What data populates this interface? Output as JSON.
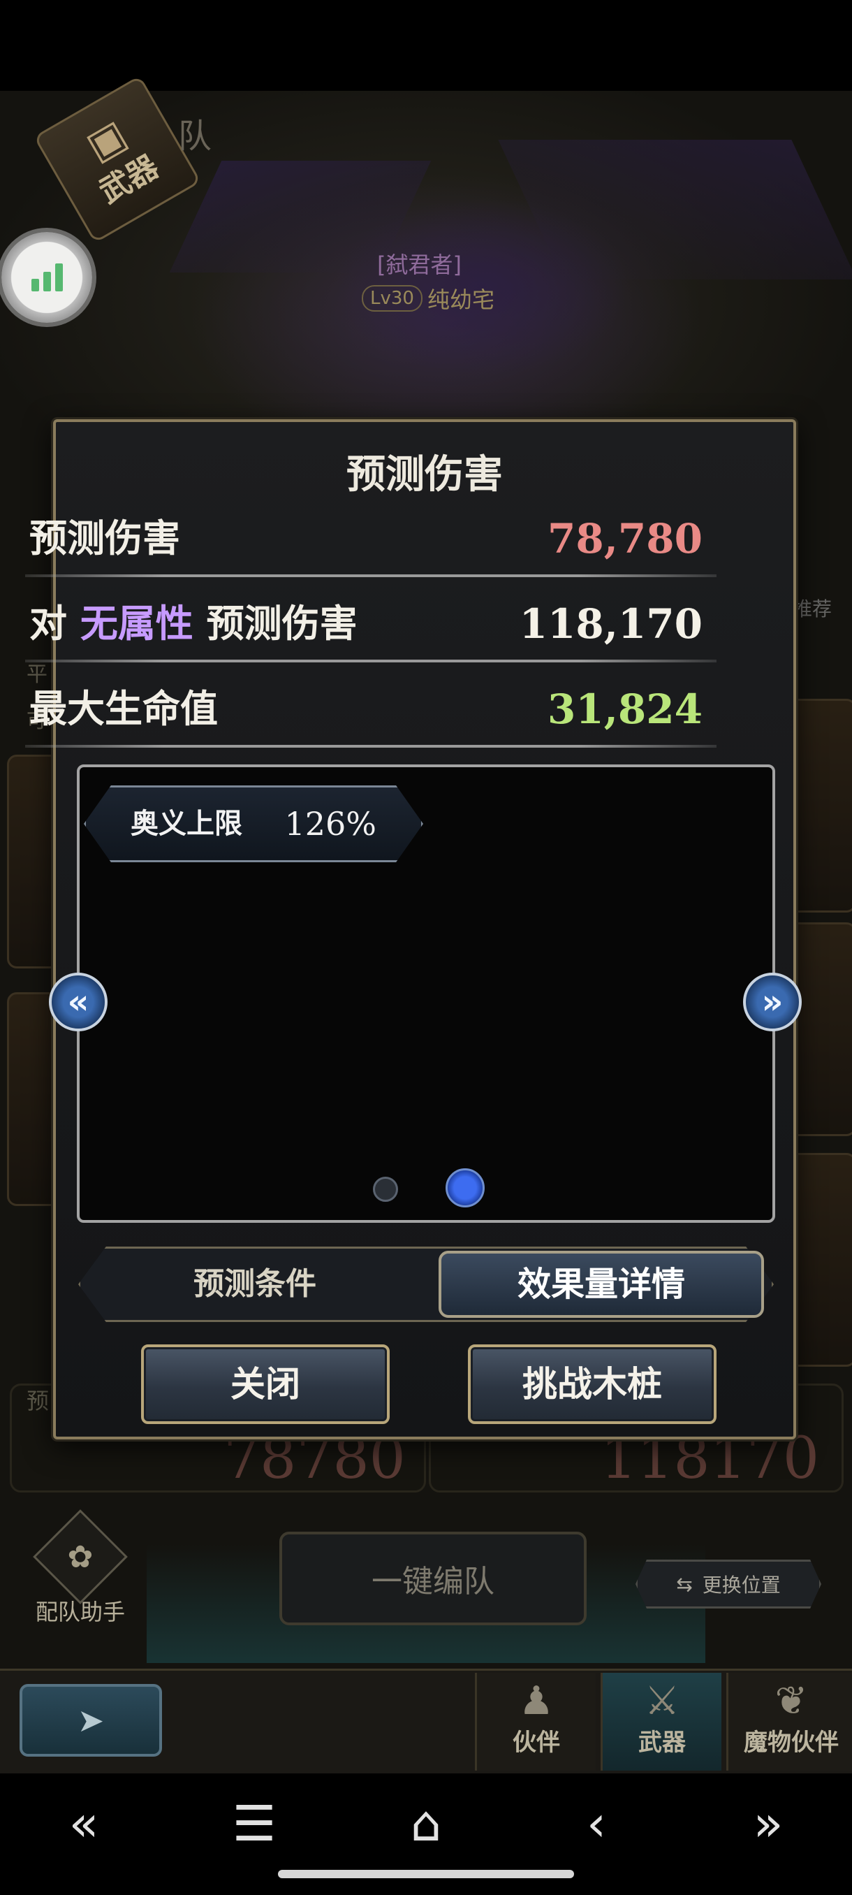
{
  "background": {
    "weapon_tab_badge": {
      "icon": "weapon-chest-icon",
      "label": "武器"
    },
    "team_title_fragment": "队",
    "enemy": {
      "title": "[弑君者]",
      "level": "Lv30",
      "name": "纯幼宅"
    },
    "left_labels": {
      "ping": "平",
      "ke": "可",
      "yu": "预"
    },
    "recommend_label": "推荐",
    "damage_left": "78780",
    "damage_right": "118170",
    "assist": {
      "icon": "gear-leaf-icon",
      "label": "配队助手"
    },
    "auto_team_label": "一键编队",
    "swap_position_label": "更换位置",
    "tabs": [
      {
        "label": "伙伴",
        "icon": "partner-icon"
      },
      {
        "label": "武器",
        "icon": "crossed-swords-icon"
      },
      {
        "label": "魔物伙伴",
        "icon": "monster-icon"
      }
    ]
  },
  "modal": {
    "title": "预测伤害",
    "rows": {
      "predicted": {
        "label": "预测伤害",
        "value": "78,780",
        "color": "#e98a86"
      },
      "attribute": {
        "prefix": "对",
        "attribute": "无属性",
        "suffix": "预测伤害",
        "value": "118,170",
        "attr_color": "#c79bff"
      },
      "max_hp": {
        "label": "最大生命值",
        "value": "31,824",
        "color": "#b9e57a"
      }
    },
    "limit_tag": {
      "label": "奥义上限",
      "value": "126%"
    },
    "pagination": {
      "current": 2,
      "total": 2
    },
    "segments": {
      "conditions": "预测条件",
      "effects": "效果量详情",
      "active": "effects"
    },
    "buttons": {
      "close": "关闭",
      "challenge": "挑战木桩"
    }
  },
  "system_nav": {
    "prev": "«",
    "menu": "☰",
    "home": "⌂",
    "back": "‹",
    "next": "»"
  }
}
